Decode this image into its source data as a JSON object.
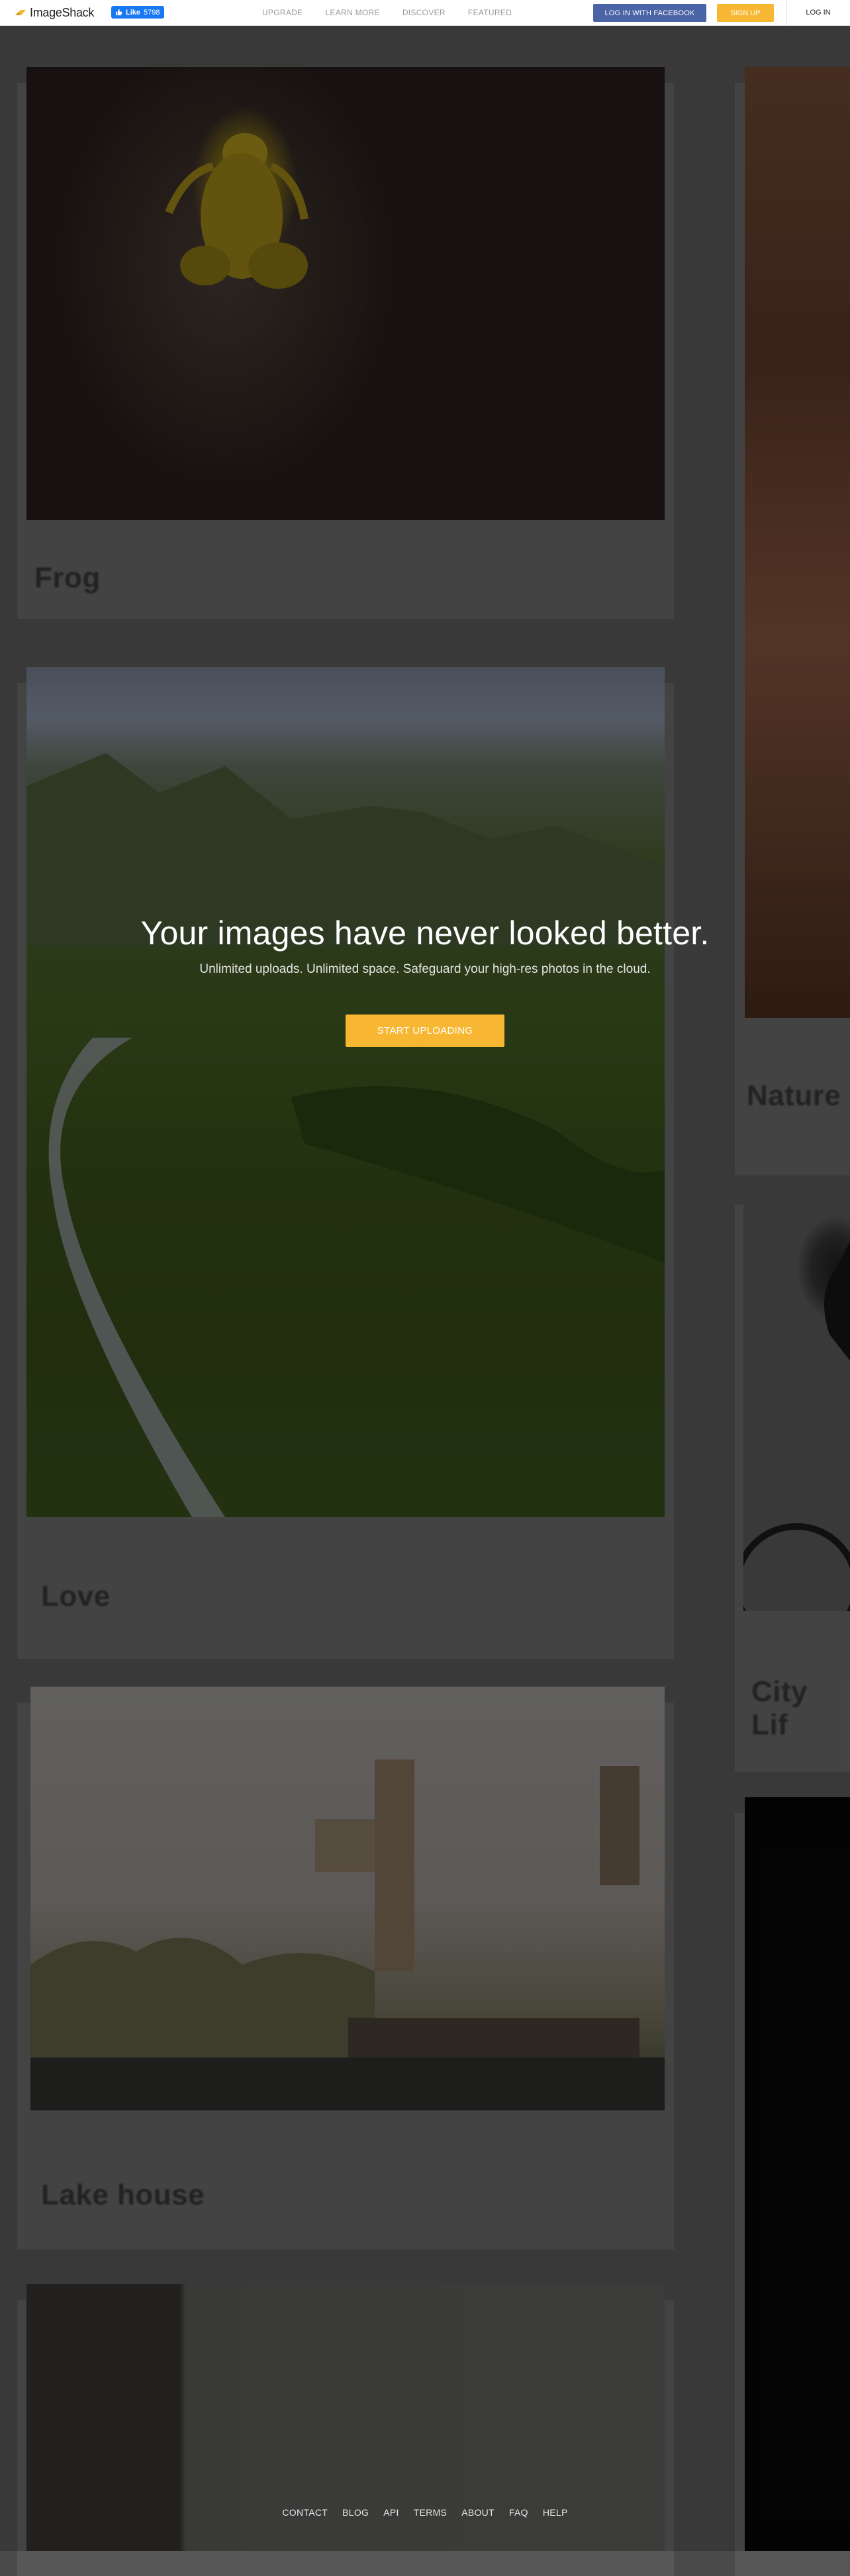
{
  "header": {
    "logo_text": "ImageShack",
    "fb_like_label": "Like",
    "fb_like_count": "5798",
    "nav": [
      "UPGRADE",
      "LEARN MORE",
      "DISCOVER",
      "FEATURED"
    ],
    "fb_login_label": "LOG IN WITH FACEBOOK",
    "signup_label": "SIGN UP",
    "login_label": "LOG IN",
    "accent_color": "#f7b733",
    "facebook_color": "#4b64a6"
  },
  "hero": {
    "title": "Your images have never looked better.",
    "subtitle": "Unlimited uploads. Unlimited space. Safeguard your high-res photos in the cloud.",
    "cta_label": "START UPLOADING"
  },
  "cards": {
    "frog": "Frog",
    "love": "Love",
    "lake_house": "Lake house",
    "nature": "Nature",
    "city_life": "City Lif"
  },
  "footer": {
    "links": [
      "CONTACT",
      "BLOG",
      "API",
      "TERMS",
      "ABOUT",
      "FAQ",
      "HELP"
    ]
  }
}
